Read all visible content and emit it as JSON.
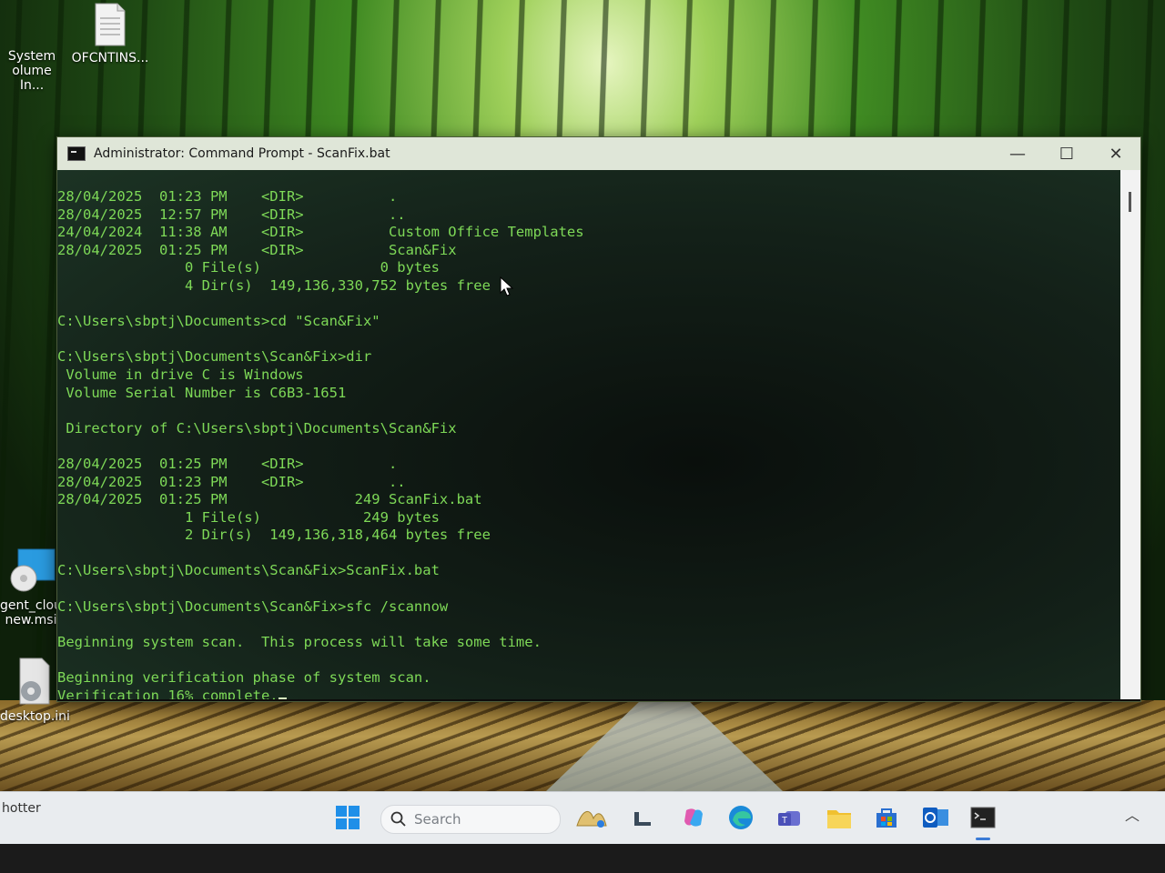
{
  "desktop": {
    "icons": [
      {
        "label_line1": "System",
        "label_line2": "olume In..."
      },
      {
        "label": "OFCNTINS..."
      },
      {
        "label_line1": "gent_clou",
        "label_line2": "new.msi"
      },
      {
        "label": "desktop.ini"
      }
    ]
  },
  "window": {
    "title": "Administrator: Command Prompt - ScanFix.bat",
    "controls": {
      "minimize": "—",
      "maximize": "☐",
      "close": "✕"
    }
  },
  "console": {
    "lines": [
      "28/04/2025  01:23 PM    <DIR>          .",
      "28/04/2025  12:57 PM    <DIR>          ..",
      "24/04/2024  11:38 AM    <DIR>          Custom Office Templates",
      "28/04/2025  01:25 PM    <DIR>          Scan&Fix",
      "               0 File(s)              0 bytes",
      "               4 Dir(s)  149,136,330,752 bytes free",
      "",
      "C:\\Users\\sbptj\\Documents>cd \"Scan&Fix\"",
      "",
      "C:\\Users\\sbptj\\Documents\\Scan&Fix>dir",
      " Volume in drive C is Windows",
      " Volume Serial Number is C6B3-1651",
      "",
      " Directory of C:\\Users\\sbptj\\Documents\\Scan&Fix",
      "",
      "28/04/2025  01:25 PM    <DIR>          .",
      "28/04/2025  01:23 PM    <DIR>          ..",
      "28/04/2025  01:25 PM               249 ScanFix.bat",
      "               1 File(s)            249 bytes",
      "               2 Dir(s)  149,136,318,464 bytes free",
      "",
      "C:\\Users\\sbptj\\Documents\\Scan&Fix>ScanFix.bat",
      "",
      "C:\\Users\\sbptj\\Documents\\Scan&Fix>sfc /scannow",
      "",
      "Beginning system scan.  This process will take some time.",
      "",
      "Beginning verification phase of system scan.",
      "Verification 16% complete."
    ]
  },
  "taskbar": {
    "left_text": "hotter",
    "search_placeholder": "Search",
    "pinned": [
      "start-icon",
      "search-icon",
      "widget-icon",
      "file-explorer-icon",
      "copilot-icon",
      "edge-icon",
      "teams-icon",
      "folder-icon",
      "store-icon",
      "outlook-icon",
      "terminal-icon"
    ]
  }
}
